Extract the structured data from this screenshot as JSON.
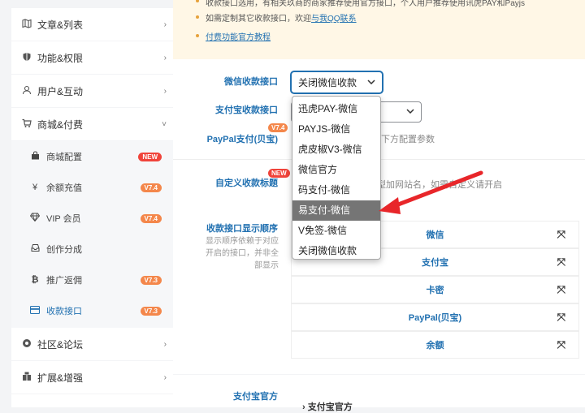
{
  "sidebar": {
    "groups_top": [
      {
        "label": "文章&列表",
        "icon": "map-icon"
      },
      {
        "label": "功能&权限",
        "icon": "shield-icon"
      },
      {
        "label": "用户&互动",
        "icon": "user-icon"
      },
      {
        "label": "商城&付费",
        "icon": "cart-icon"
      }
    ],
    "sub_items": [
      {
        "label": "商城配置",
        "icon": "shop-bag-icon",
        "badge": "NEW"
      },
      {
        "label": "余额充值",
        "icon": "yen-icon",
        "badge": "V7.4"
      },
      {
        "label": "VIP 会员",
        "icon": "diamond-icon",
        "badge": "V7.4"
      },
      {
        "label": "创作分成",
        "icon": "inbox-icon",
        "badge": ""
      },
      {
        "label": "推广返佣",
        "icon": "bitcoin-icon",
        "badge": "V7.3"
      },
      {
        "label": "收款接口",
        "icon": "credit-card-icon",
        "badge": "V7.3"
      }
    ],
    "groups_bottom": [
      {
        "label": "社区&论坛",
        "icon": "forum-icon"
      },
      {
        "label": "扩展&增强",
        "icon": "puzzle-icon"
      }
    ]
  },
  "notice": {
    "line1": "收款接口选用，有相关玖商的商家推荐使用官方接口，个人用户推荐使用讯虎PAY和Payjs",
    "line2_prefix": "如需定制其它收款接口，欢迎",
    "line2_link": "与我QQ联系",
    "line3_link": "付费功能官方教程"
  },
  "form": {
    "wechat_label": "微信收款接口",
    "wechat_value": "关闭微信收款",
    "alipay_label": "支付宝收款接口",
    "paypal_label": "PayPal支付(贝宝)",
    "paypal_tag": "V7.4",
    "paypal_desc": "下方配置参数",
    "custom_label": "自定义收款标题",
    "custom_tag": "NEW",
    "custom_desc": "类型加网站名，如需自定义请开启",
    "order_label": "收款接口显示顺序",
    "order_hint": "显示顺序依赖于对应开启的接口，并非全部显示",
    "order_items": [
      "微信",
      "支付宝",
      "卡密",
      "PayPal(贝宝)",
      "余额"
    ],
    "alipay_official_label": "支付宝官方",
    "alipay_official_collapse": "支付宝官方"
  },
  "dropdown": {
    "options": [
      "迅虎PAY-微信",
      "PAYJS-微信",
      "虎皮椒V3-微信",
      "微信官方",
      "码支付-微信",
      "易支付-微信",
      "V免签-微信",
      "关闭微信收款"
    ],
    "highlighted_index": 5
  },
  "colors": {
    "accent": "#2271b1",
    "badge_new": "#f0433a",
    "badge_ver": "#f4874b",
    "arrow": "#e8262a"
  }
}
